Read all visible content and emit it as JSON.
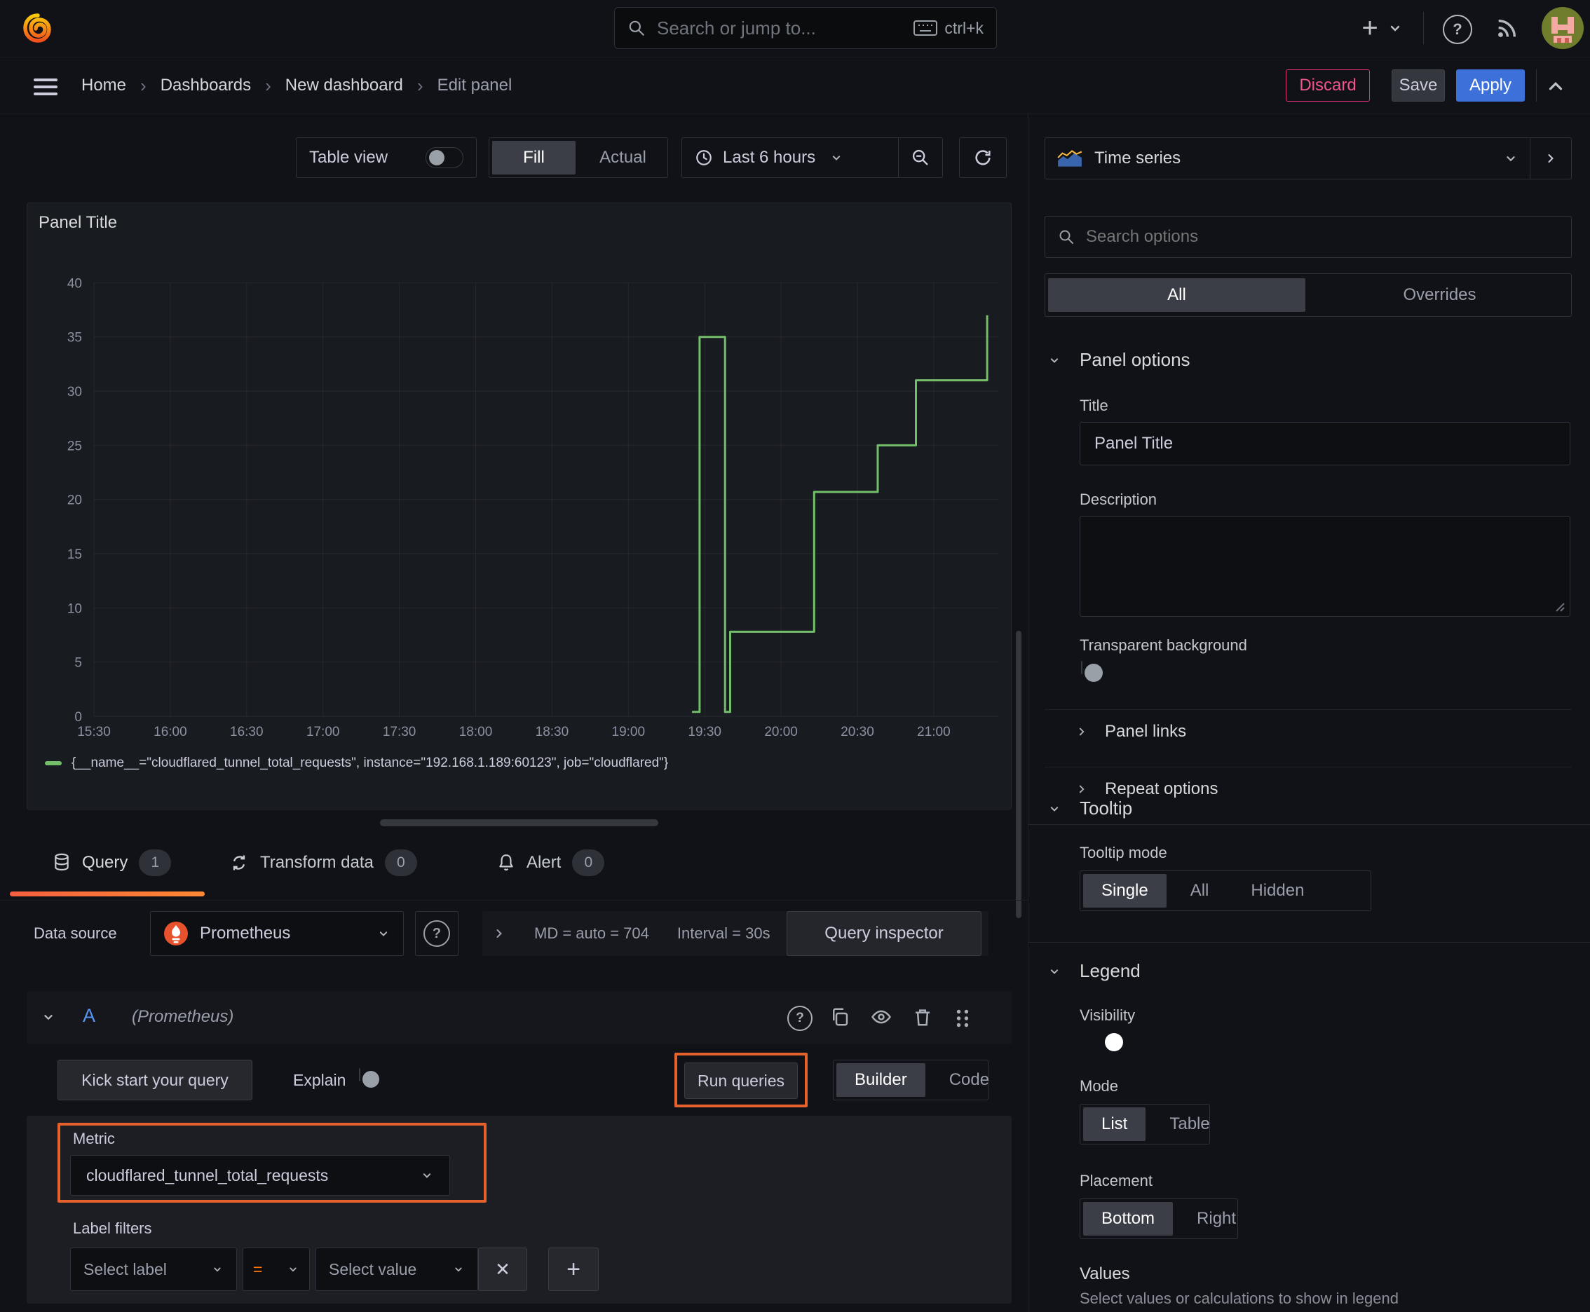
{
  "glyphs": {
    "question": "?",
    "plus": "+",
    "close": "✕",
    "breadcrumb_separator": "›"
  },
  "colors": {
    "background": "#111217",
    "panel": "#181b1f",
    "accent_blue": "#3d71d9",
    "orange_highlight": "#e5622d",
    "series_green": "#73bf69",
    "discard_pink": "#f2548d",
    "tab_underline_orange": "#ff8833"
  },
  "header": {
    "search_placeholder": "Search or jump to...",
    "search_shortcut": "ctrl+k"
  },
  "breadcrumb": {
    "items": [
      "Home",
      "Dashboards",
      "New dashboard",
      "Edit panel"
    ]
  },
  "actions": {
    "discard": "Discard",
    "save": "Save",
    "apply": "Apply"
  },
  "toolbar": {
    "table_view": "Table view",
    "fill": "Fill",
    "actual": "Actual",
    "time_range": "Last 6 hours"
  },
  "panel": {
    "title": "Panel Title"
  },
  "chart_data": {
    "type": "line",
    "title": "Panel Title",
    "x_ticks": [
      "15:30",
      "16:00",
      "16:30",
      "17:00",
      "17:30",
      "18:00",
      "18:30",
      "19:00",
      "19:30",
      "20:00",
      "20:30",
      "21:00"
    ],
    "y_ticks": [
      0,
      5,
      10,
      15,
      20,
      25,
      30,
      35,
      40
    ],
    "ylim": [
      0,
      41
    ],
    "xlabel": "",
    "ylabel": "",
    "grid": true,
    "legend_position": "bottom",
    "series": [
      {
        "name": "{__name__=\"cloudflared_tunnel_total_requests\", instance=\"192.168.1.189:60123\", job=\"cloudflared\"}",
        "color": "#73bf69",
        "interpolation": "step-after",
        "step_points": [
          [
            "19:25",
            0.4
          ],
          [
            "19:28",
            35
          ],
          [
            "19:38",
            0.4
          ],
          [
            "19:40",
            7.8
          ],
          [
            "20:13",
            20.7
          ],
          [
            "20:38",
            25
          ],
          [
            "20:53",
            31
          ],
          [
            "21:21",
            37
          ]
        ]
      }
    ]
  },
  "tabs": [
    {
      "label": "Query",
      "count": 1
    },
    {
      "label": "Transform data",
      "count": 0
    },
    {
      "label": "Alert",
      "count": 0
    }
  ],
  "query": {
    "datasource_label": "Data source",
    "datasource": "Prometheus",
    "options_md": "MD = auto = 704",
    "options_interval": "Interval = 30s",
    "inspector": "Query inspector",
    "ref_id": "A",
    "ref_datasource": "(Prometheus)",
    "kickstart": "Kick start your query",
    "explain": "Explain",
    "run_queries": "Run queries",
    "builder": "Builder",
    "code": "Code",
    "metric_label": "Metric",
    "metric_value": "cloudflared_tunnel_total_requests",
    "label_filters_label": "Label filters",
    "select_label_placeholder": "Select label",
    "operator": "=",
    "select_value_placeholder": "Select value"
  },
  "sidebar": {
    "visualization": "Time series",
    "search_placeholder": "Search options",
    "filter_tabs": {
      "all": "All",
      "overrides": "Overrides"
    },
    "panel_options": {
      "heading": "Panel options",
      "title_label": "Title",
      "title_value": "Panel Title",
      "description_label": "Description",
      "transparent_label": "Transparent background"
    },
    "collapsed": {
      "panel_links": "Panel links",
      "repeat_options": "Repeat options"
    },
    "tooltip": {
      "heading": "Tooltip",
      "mode_label": "Tooltip mode",
      "options": [
        "Single",
        "All",
        "Hidden"
      ],
      "selected": "Single"
    },
    "legend": {
      "heading": "Legend",
      "visibility_label": "Visibility",
      "mode_label": "Mode",
      "mode_options": [
        "List",
        "Table"
      ],
      "mode_selected": "List",
      "placement_label": "Placement",
      "placement_options": [
        "Bottom",
        "Right"
      ],
      "placement_selected": "Bottom",
      "values_label": "Values",
      "values_help": "Select values or calculations to show in legend"
    }
  }
}
